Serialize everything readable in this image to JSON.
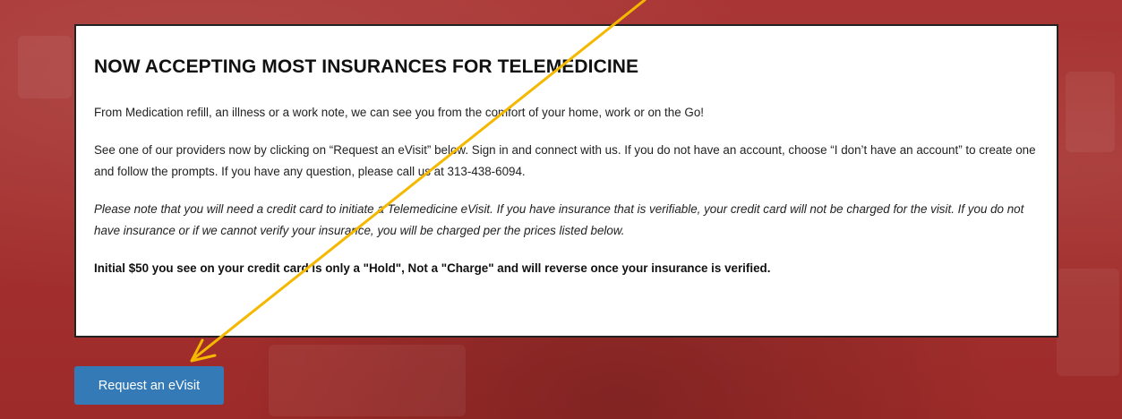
{
  "card": {
    "heading": "NOW ACCEPTING MOST INSURANCES FOR TELEMEDICINE",
    "paragraph1": "From Medication refill, an illness or a work note, we can see you from the comfort of your home, work or on the Go!",
    "paragraph2": "See one of our providers now by clicking on “Request an eVisit” below. Sign in and connect with us. If you do not have an account, choose “I don’t have an account” to create one and follow the prompts. If you have any question, please call us at 313-438-6094.",
    "note": "Please note that you will need a credit card to initiate a Telemedicine eVisit. If you have insurance that is verifiable, your credit card will not be charged for the visit. If you do not have insurance or if we cannot verify your insurance, you will be charged per the prices listed below.",
    "hold_notice": "Initial $50 you see on your credit card is only a \"Hold\", Not a \"Charge\" and will reverse once your insurance is verified."
  },
  "request_button_label": "Request an eVisit",
  "colors": {
    "background": "#a8302f",
    "button": "#337ab7",
    "annotation_arrow": "#f5b800"
  }
}
